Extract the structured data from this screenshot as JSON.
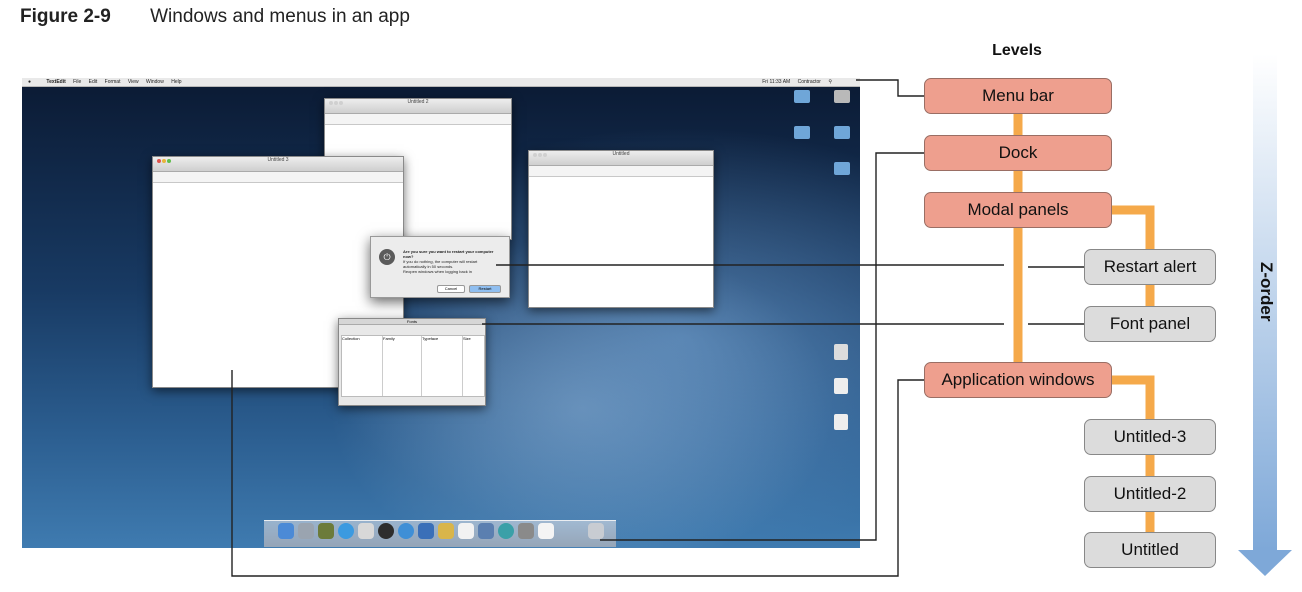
{
  "figure": {
    "number": "Figure 2-9",
    "caption": "Windows and menus in an app"
  },
  "levels_heading": "Levels",
  "z_axis_label": "Z-order",
  "levels": {
    "menu_bar": "Menu bar",
    "dock": "Dock",
    "modal_panels": "Modal panels",
    "restart_alert": "Restart alert",
    "font_panel": "Font panel",
    "application_windows": "Application windows",
    "untitled_3": "Untitled-3",
    "untitled_2": "Untitled-2",
    "untitled": "Untitled"
  },
  "screenshot": {
    "menubar": {
      "app_name": "TextEdit",
      "menus": [
        "File",
        "Edit",
        "Format",
        "View",
        "Window",
        "Help"
      ],
      "clock": "Fri 11:33 AM",
      "user": "Contractor"
    },
    "windows": {
      "untitled_3_title": "Untitled 3",
      "untitled_2_title": "Untitled 2",
      "untitled_title": "Untitled"
    },
    "alert": {
      "title": "Are you sure you want to restart your computer now?",
      "message": "If you do nothing, the computer will restart automatically in 50 seconds.",
      "checkbox": "Reopen windows when logging back in",
      "cancel": "Cancel",
      "restart": "Restart"
    },
    "font_panel": {
      "title": "Fonts",
      "columns": [
        "Collection",
        "Family",
        "Typeface",
        "Size"
      ]
    }
  },
  "colors": {
    "level_box": "#ee9f8e",
    "sub_box": "#dcdcdc",
    "connector": "#f5a94a",
    "arrow": "#7ea8d8"
  }
}
